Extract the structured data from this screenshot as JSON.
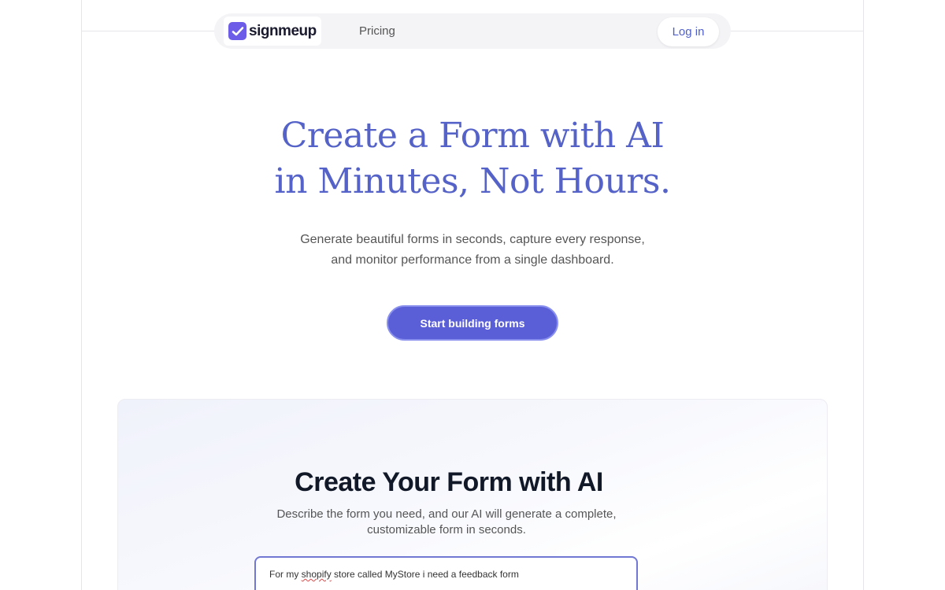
{
  "brand": {
    "name": "signmeup",
    "accent": "#6c5ce7"
  },
  "nav": {
    "pricing_label": "Pricing",
    "login_label": "Log in"
  },
  "hero": {
    "title_line1": "Create a Form with AI",
    "title_line2": "in Minutes, Not Hours.",
    "subtitle_line1": "Generate beautiful forms in seconds, capture every response,",
    "subtitle_line2": "and monitor performance from a single dashboard.",
    "cta_label": "Start building forms",
    "title_color": "#5563c8",
    "cta_color": "#5a5fd8"
  },
  "ai_section": {
    "title": "Create Your Form with AI",
    "subtitle_line1": "Describe the form you need, and our AI will generate a complete,",
    "subtitle_line2": "customizable form in seconds.",
    "prompt_before": "For my ",
    "prompt_misspelled": "shopify",
    "prompt_after": " store called MyStore i need a feedback form"
  }
}
